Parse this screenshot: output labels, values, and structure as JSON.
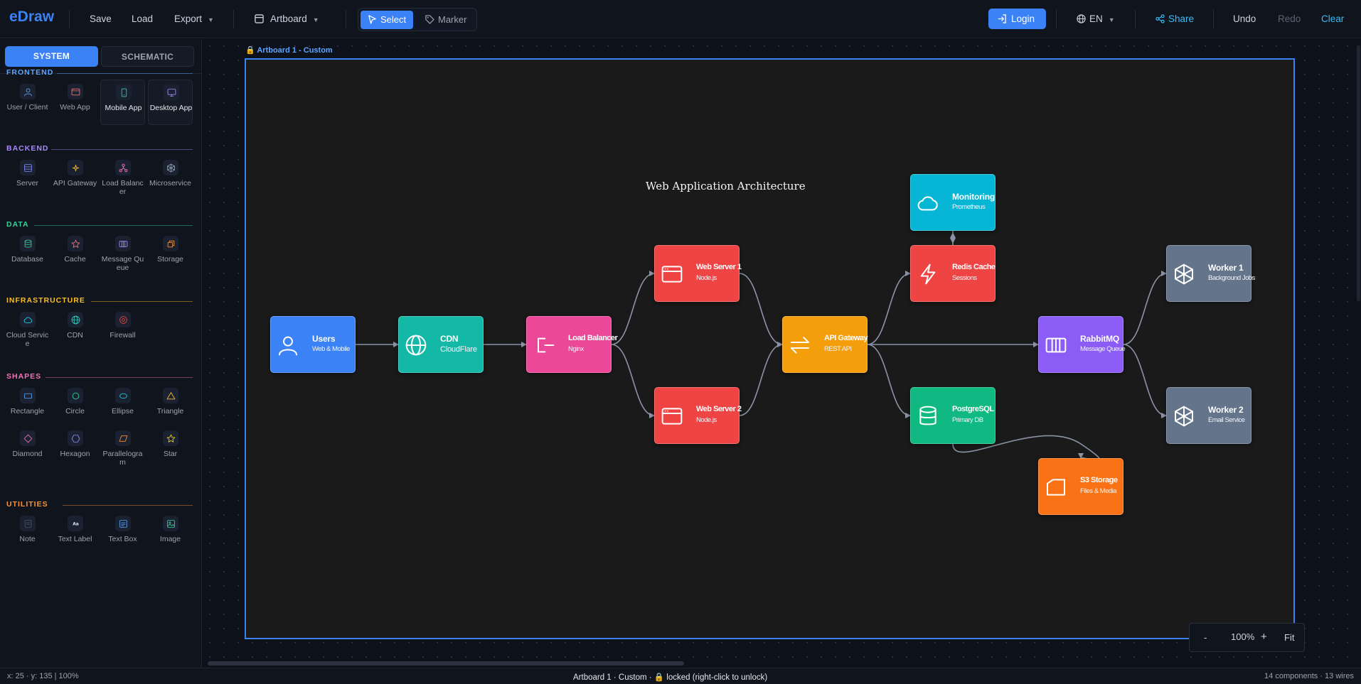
{
  "app": {
    "name": "eDraw"
  },
  "toolbar": {
    "save": "Save",
    "load": "Load",
    "export": "Export",
    "artboard": "Artboard",
    "select": "Select",
    "marker": "Marker",
    "login": "Login",
    "language": "EN",
    "share": "Share",
    "undo": "Undo",
    "redo": "Redo",
    "clear": "Clear"
  },
  "sidebar": {
    "tabs": [
      "SYSTEM",
      "SCHEMATIC"
    ],
    "sections": [
      {
        "title": "FRONTEND",
        "color": "#60a5fa",
        "items": [
          {
            "label": "User / Client",
            "icon": "user-icon",
            "color": "#60a5fa"
          },
          {
            "label": "Web App",
            "icon": "browser-icon",
            "color": "#f87171"
          },
          {
            "label": "Mobile App",
            "icon": "smartphone-icon",
            "color": "#34d399"
          },
          {
            "label": "Desktop App",
            "icon": "monitor-icon",
            "color": "#a78bfa"
          }
        ]
      },
      {
        "title": "BACKEND",
        "color": "#a78bfa",
        "items": [
          {
            "label": "Server",
            "icon": "server-icon",
            "color": "#818cf8"
          },
          {
            "label": "API Gateway",
            "icon": "sparkle-icon",
            "color": "#fbbf24"
          },
          {
            "label": "Load Balancer",
            "icon": "network-icon",
            "color": "#f472b6"
          },
          {
            "label": "Microservice",
            "icon": "hexagon-cog-icon",
            "color": "#94a3b8"
          }
        ]
      },
      {
        "title": "DATA",
        "color": "#34d399",
        "items": [
          {
            "label": "Database",
            "icon": "database-icon",
            "color": "#34d399"
          },
          {
            "label": "Cache",
            "icon": "star-icon",
            "color": "#f87171"
          },
          {
            "label": "Message Queue",
            "icon": "queue-icon",
            "color": "#a78bfa"
          },
          {
            "label": "Storage",
            "icon": "box-icon",
            "color": "#fb923c"
          }
        ]
      },
      {
        "title": "INFRASTRUCTURE",
        "color": "#fbbf24",
        "items": [
          {
            "label": "Cloud Service",
            "icon": "cloud-icon",
            "color": "#22d3ee"
          },
          {
            "label": "CDN",
            "icon": "globe-icon",
            "color": "#2dd4bf"
          },
          {
            "label": "Firewall",
            "icon": "shield-icon",
            "color": "#ef4444"
          }
        ]
      },
      {
        "title": "SHAPES",
        "color": "#f472b6",
        "items": [
          {
            "label": "Rectangle",
            "icon": "rectangle-icon",
            "color": "#60a5fa"
          },
          {
            "label": "Circle",
            "icon": "circle-icon",
            "color": "#34d399"
          },
          {
            "label": "Ellipse",
            "icon": "ellipse-icon",
            "color": "#22d3ee"
          },
          {
            "label": "Triangle",
            "icon": "triangle-icon",
            "color": "#fbbf24"
          },
          {
            "label": "Diamond",
            "icon": "diamond-icon",
            "color": "#f472b6"
          },
          {
            "label": "Hexagon",
            "icon": "hexagon-icon",
            "color": "#818cf8"
          },
          {
            "label": "Parallelogram",
            "icon": "parallelogram-icon",
            "color": "#fb923c"
          },
          {
            "label": "Star",
            "icon": "star-outline-icon",
            "color": "#facc15"
          }
        ]
      },
      {
        "title": "UTILITIES",
        "color": "#fb923c",
        "items": [
          {
            "label": "Note",
            "icon": "note-icon",
            "color": "#4b5563"
          },
          {
            "label": "Text Label",
            "icon": "text-icon",
            "color": "#e5e7eb"
          },
          {
            "label": "Text Box",
            "icon": "textbox-icon",
            "color": "#60a5fa"
          },
          {
            "label": "Image",
            "icon": "image-icon",
            "color": "#34d399"
          }
        ]
      }
    ]
  },
  "artboard": {
    "label": "Artboard 1 - Custom",
    "title": "Web Application Architecture"
  },
  "nodes": [
    {
      "id": "users",
      "title": "Users",
      "subtitle": "Web & Mobile",
      "color": "#3b82f6",
      "icon": "user-icon"
    },
    {
      "id": "cdn",
      "title": "CDN",
      "subtitle": "CloudFlare",
      "color": "#14b8a6",
      "icon": "globe-icon"
    },
    {
      "id": "lb",
      "title": "Load Balancer",
      "subtitle": "Nginx",
      "color": "#ec4899",
      "icon": "split-icon"
    },
    {
      "id": "ws1",
      "title": "Web Server 1",
      "subtitle": "Node.js",
      "color": "#ef4444",
      "icon": "browser-icon"
    },
    {
      "id": "ws2",
      "title": "Web Server 2",
      "subtitle": "Node.js",
      "color": "#ef4444",
      "icon": "browser-icon"
    },
    {
      "id": "api",
      "title": "API Gateway",
      "subtitle": "REST API",
      "color": "#f59e0b",
      "icon": "arrows-icon"
    },
    {
      "id": "mon",
      "title": "Monitoring",
      "subtitle": "Prometheus",
      "color": "#06b6d4",
      "icon": "cloud-icon"
    },
    {
      "id": "redis",
      "title": "Redis Cache",
      "subtitle": "Sessions",
      "color": "#ef4444",
      "icon": "lightning-icon"
    },
    {
      "id": "pg",
      "title": "PostgreSQL",
      "subtitle": "Primary DB",
      "color": "#10b981",
      "icon": "database-icon"
    },
    {
      "id": "rmq",
      "title": "RabbitMQ",
      "subtitle": "Message Queue",
      "color": "#8b5cf6",
      "icon": "queue-icon"
    },
    {
      "id": "s3",
      "title": "S3 Storage",
      "subtitle": "Files & Media",
      "color": "#f97316",
      "icon": "folder-icon"
    },
    {
      "id": "w1",
      "title": "Worker 1",
      "subtitle": "Background Jobs",
      "color": "#64748b",
      "icon": "hexagon-cog-icon"
    },
    {
      "id": "w2",
      "title": "Worker 2",
      "subtitle": "Email Service",
      "color": "#64748b",
      "icon": "hexagon-cog-icon"
    }
  ],
  "zoom": {
    "minus": "-",
    "level": "100%",
    "plus": "+",
    "fit": "Fit"
  },
  "status": {
    "cursor": "x: 25 · y: 135 | 100%",
    "artboard_info": "Artboard 1 · Custom · ",
    "lock_text": "locked (right-click to unlock)",
    "counts": "14 components · 13 wires"
  }
}
